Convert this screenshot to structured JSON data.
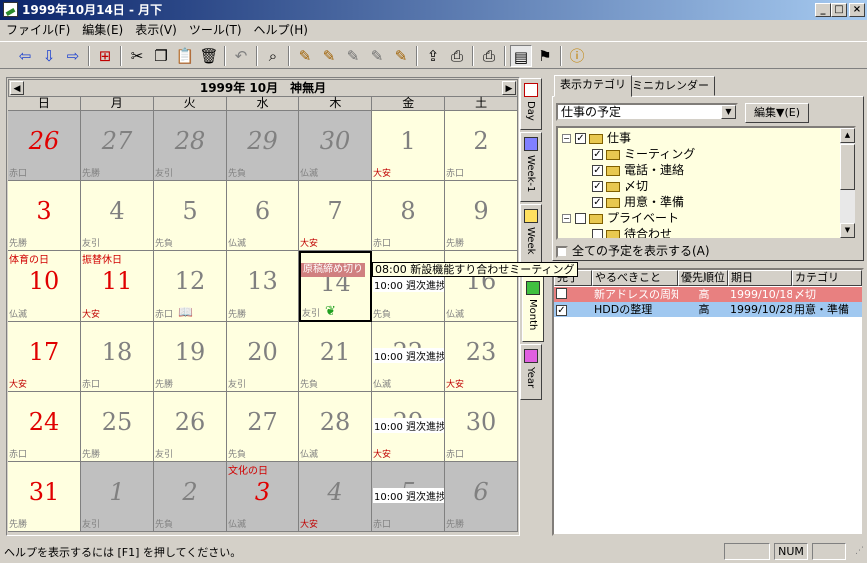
{
  "window": {
    "title": "1999年10月14日 - 月下"
  },
  "menu": [
    "ファイル(F)",
    "編集(E)",
    "表示(V)",
    "ツール(T)",
    "ヘルプ(H)"
  ],
  "calendar": {
    "title": "1999年 10月　神無月",
    "weekdays": [
      "日",
      "月",
      "火",
      "水",
      "木",
      "金",
      "土"
    ],
    "weeks": [
      [
        {
          "day": "26",
          "rokuyo": "赤口",
          "other": true,
          "red": true
        },
        {
          "day": "27",
          "rokuyo": "先勝",
          "other": true
        },
        {
          "day": "28",
          "rokuyo": "友引",
          "other": true
        },
        {
          "day": "29",
          "rokuyo": "先負",
          "other": true
        },
        {
          "day": "30",
          "rokuyo": "仏滅",
          "other": true
        },
        {
          "day": "1",
          "rokuyo": "大安",
          "rokuyo_red": true
        },
        {
          "day": "2",
          "rokuyo": "赤口"
        }
      ],
      [
        {
          "day": "3",
          "rokuyo": "先勝",
          "red": true
        },
        {
          "day": "4",
          "rokuyo": "友引"
        },
        {
          "day": "5",
          "rokuyo": "先負"
        },
        {
          "day": "6",
          "rokuyo": "仏滅"
        },
        {
          "day": "7",
          "rokuyo": "大安",
          "rokuyo_red": true
        },
        {
          "day": "8",
          "rokuyo": "赤口"
        },
        {
          "day": "9",
          "rokuyo": "先勝"
        }
      ],
      [
        {
          "day": "10",
          "rokuyo": "仏滅",
          "red": true,
          "holiday": "体育の日"
        },
        {
          "day": "11",
          "rokuyo": "大安",
          "red": true,
          "holiday": "振替休日",
          "rokuyo_red": true
        },
        {
          "day": "12",
          "rokuyo": "赤口",
          "icon": "book-icon"
        },
        {
          "day": "13",
          "rokuyo": "先勝"
        },
        {
          "day": "14",
          "rokuyo": "友引",
          "selected": true,
          "icon": "leaf-icon"
        },
        {
          "day": "15",
          "rokuyo": "先負",
          "event": "10:00 週次進捗"
        },
        {
          "day": "16",
          "rokuyo": "仏滅"
        }
      ],
      [
        {
          "day": "17",
          "rokuyo": "大安",
          "red": true,
          "rokuyo_red": true
        },
        {
          "day": "18",
          "rokuyo": "赤口"
        },
        {
          "day": "19",
          "rokuyo": "先勝"
        },
        {
          "day": "20",
          "rokuyo": "友引"
        },
        {
          "day": "21",
          "rokuyo": "先負"
        },
        {
          "day": "22",
          "rokuyo": "仏滅",
          "event": "10:00 週次進捗"
        },
        {
          "day": "23",
          "rokuyo": "大安",
          "rokuyo_red": true
        }
      ],
      [
        {
          "day": "24",
          "rokuyo": "赤口",
          "red": true
        },
        {
          "day": "25",
          "rokuyo": "先勝"
        },
        {
          "day": "26",
          "rokuyo": "友引"
        },
        {
          "day": "27",
          "rokuyo": "先負"
        },
        {
          "day": "28",
          "rokuyo": "仏滅"
        },
        {
          "day": "29",
          "rokuyo": "大安",
          "event": "10:00 週次進捗",
          "rokuyo_red": true
        },
        {
          "day": "30",
          "rokuyo": "赤口"
        }
      ],
      [
        {
          "day": "31",
          "rokuyo": "先勝",
          "red": true
        },
        {
          "day": "1",
          "rokuyo": "友引",
          "other": true
        },
        {
          "day": "2",
          "rokuyo": "先負",
          "other": true
        },
        {
          "day": "3",
          "rokuyo": "仏滅",
          "other": true,
          "red": true,
          "holiday": "文化の日"
        },
        {
          "day": "4",
          "rokuyo": "大安",
          "other": true,
          "rokuyo_red": true
        },
        {
          "day": "5",
          "rokuyo": "赤口",
          "other": true,
          "event": "10:00 週次進捗"
        },
        {
          "day": "6",
          "rokuyo": "先勝",
          "other": true
        }
      ]
    ],
    "overlay_event": "原稿締め切り",
    "tooltip": "08:00 新設機能すり合わせミーティング"
  },
  "view_tabs": [
    "Day",
    "Week-1",
    "Week",
    "Month",
    "Year"
  ],
  "category_panel": {
    "tabs": [
      "表示カテゴリ",
      "ミニカレンダー"
    ],
    "selected": "仕事の予定",
    "edit_button": "編集▼(E)",
    "tree": [
      {
        "label": "仕事",
        "level": 0,
        "checked": true,
        "toggle": "−"
      },
      {
        "label": "ミーティング",
        "level": 1,
        "checked": true
      },
      {
        "label": "電話・連絡",
        "level": 1,
        "checked": true
      },
      {
        "label": "〆切",
        "level": 1,
        "checked": true
      },
      {
        "label": "用意・準備",
        "level": 1,
        "checked": true
      },
      {
        "label": "プライベート",
        "level": 0,
        "checked": false,
        "toggle": "−"
      },
      {
        "label": "待合わせ",
        "level": 1,
        "checked": false
      }
    ],
    "show_all": "全ての予定を表示する(A)"
  },
  "todo": {
    "columns": [
      "完了",
      "やるべきこと",
      "優先順位",
      "期日",
      "カテゴリ"
    ],
    "rows": [
      {
        "done": false,
        "task": "新アドレスの周知",
        "priority": "高",
        "due": "1999/10/18",
        "category": "〆切",
        "bg": "#e88080",
        "fg": "#ffffff"
      },
      {
        "done": true,
        "task": "HDDの整理",
        "priority": "高",
        "due": "1999/10/28",
        "category": "用意・準備",
        "bg": "#a0c8f0",
        "fg": "#000000"
      }
    ]
  },
  "status": {
    "message": "ヘルプを表示するには [F1] を押してください。",
    "num": "NUM"
  }
}
